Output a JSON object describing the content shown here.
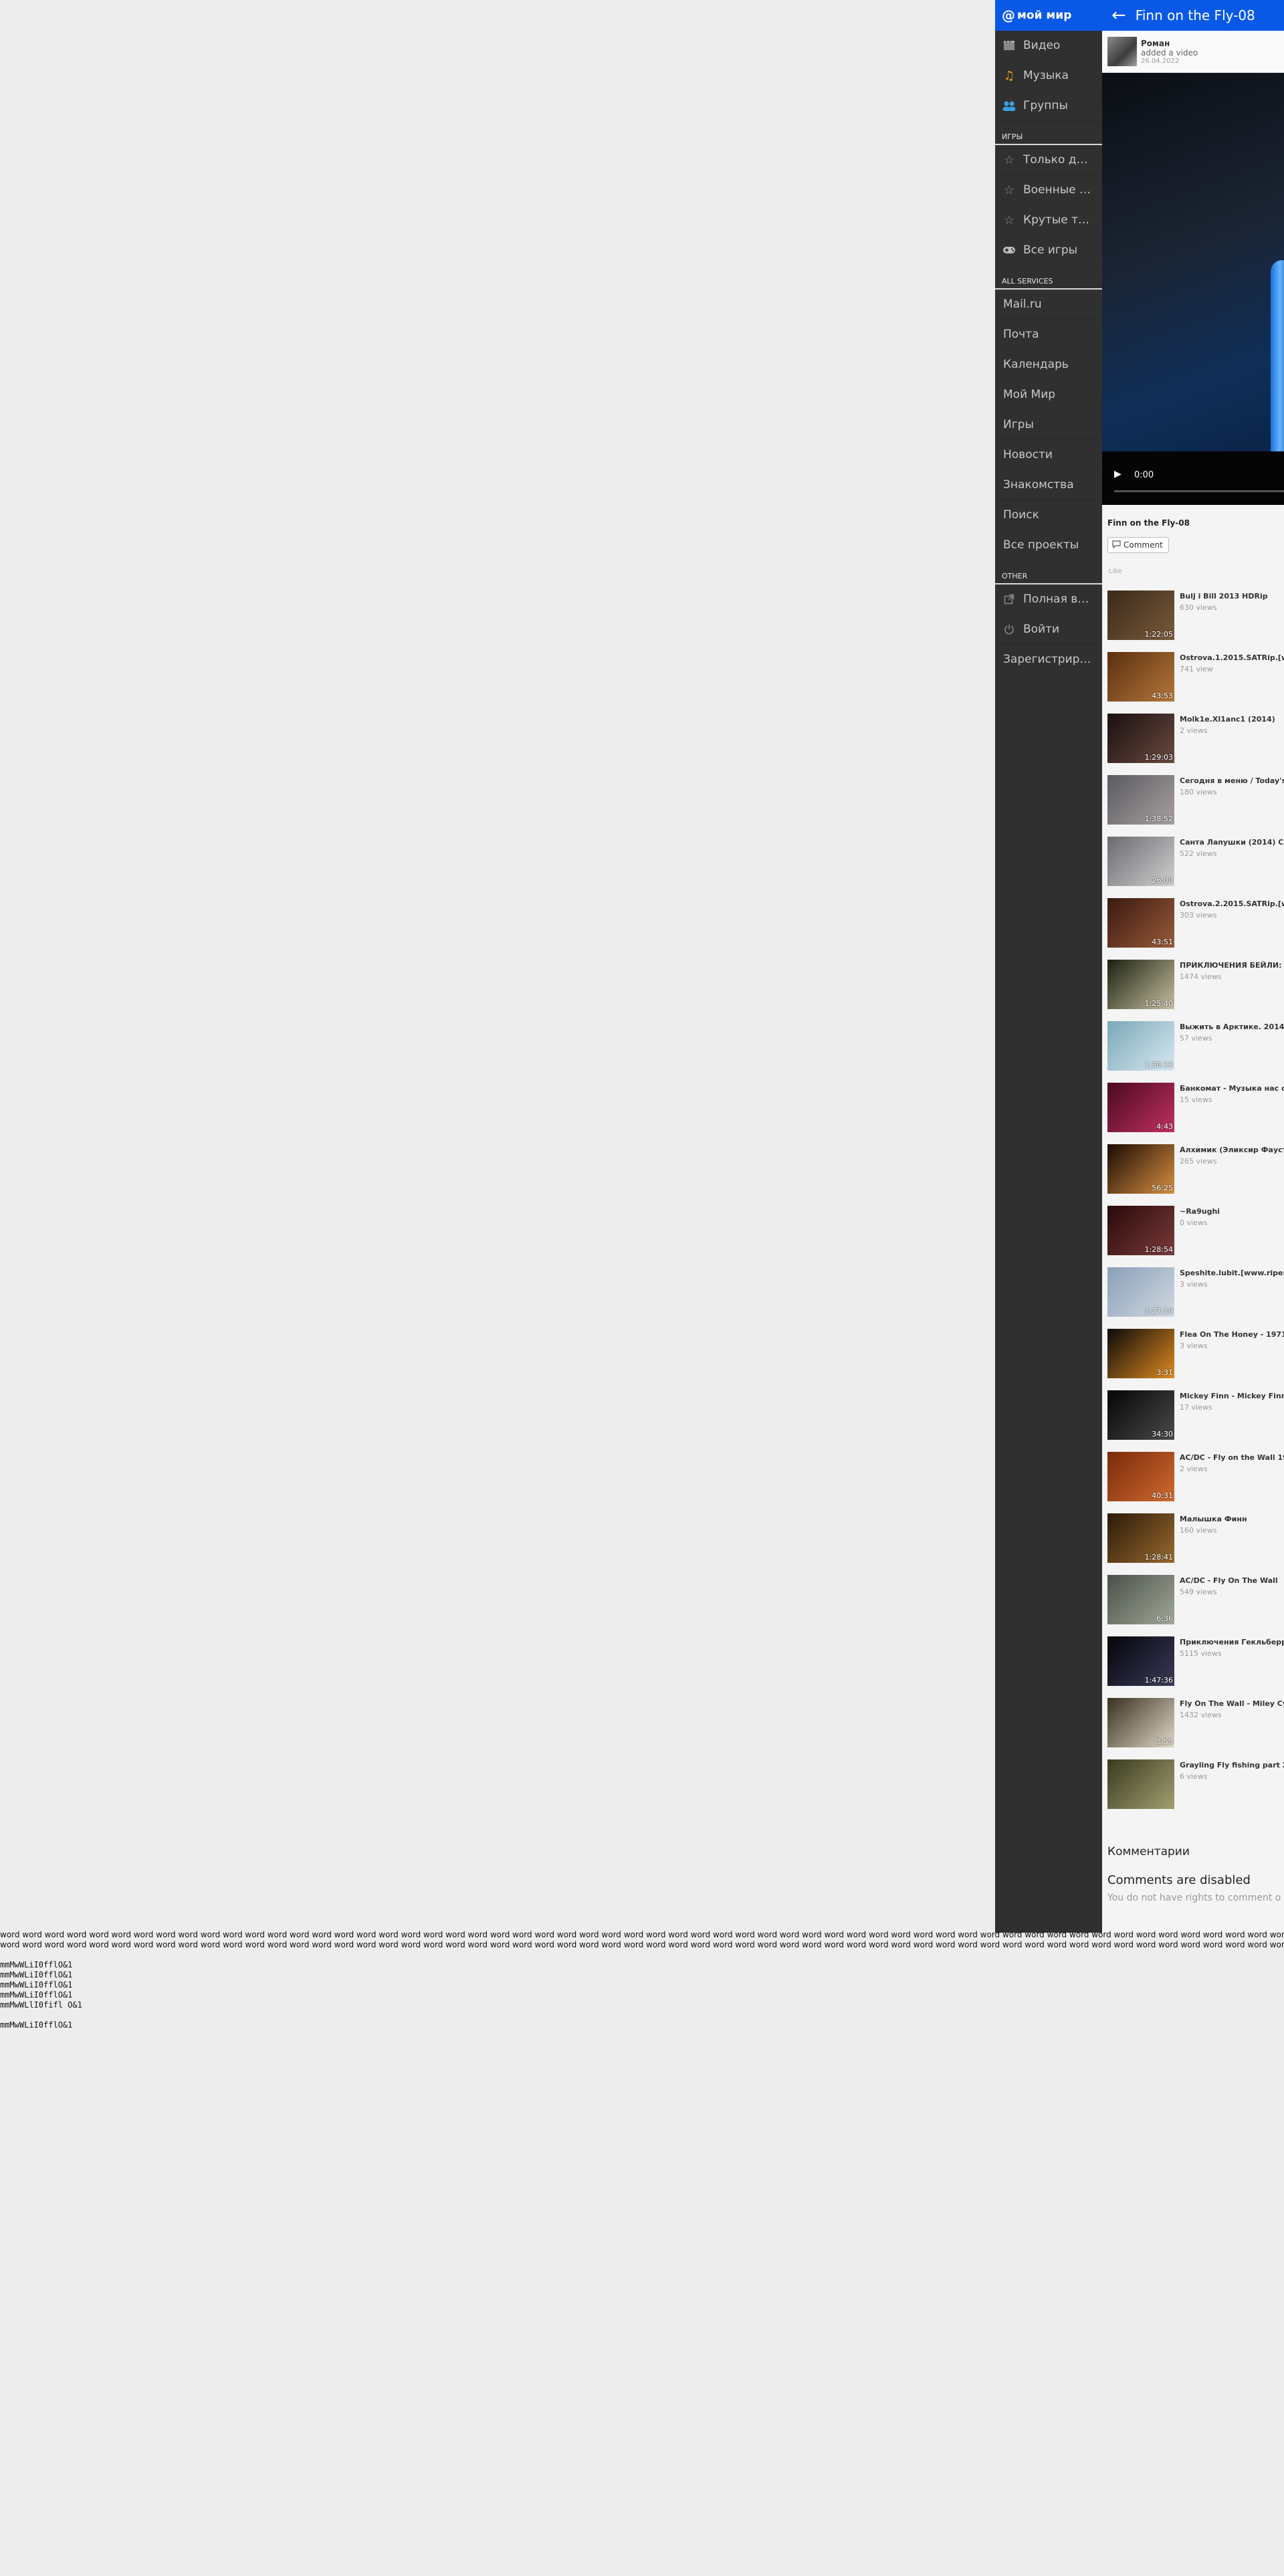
{
  "menu": {
    "brand": {
      "at": "@",
      "label": "мой мир"
    },
    "primary": [
      {
        "label": "Видео",
        "icon": "film-icon"
      },
      {
        "label": "Музыка",
        "icon": "music-note-icon"
      },
      {
        "label": "Группы",
        "icon": "people-icon"
      }
    ],
    "games_header": "ИГРЫ",
    "games": [
      {
        "label": "Только д…",
        "icon": "star-icon"
      },
      {
        "label": "Военные …",
        "icon": "star-icon"
      },
      {
        "label": "Крутые т…",
        "icon": "star-icon"
      },
      {
        "label": "Все игры",
        "icon": "gamepad-icon"
      }
    ],
    "services_header": "ALL SERVICES",
    "services": [
      "Mail.ru",
      "Почта",
      "Календарь",
      "Мой Мир",
      "Игры",
      "Новости",
      "Знакомства",
      "Поиск",
      "Все проекты"
    ],
    "other_header": "OTHER",
    "other": [
      {
        "label": "Полная в…",
        "icon": "external-link-icon"
      },
      {
        "label": "Войти",
        "icon": "power-icon"
      },
      {
        "label": "Зарегистрир…",
        "icon": ""
      }
    ]
  },
  "header": {
    "title": "Finn on the Fly-08"
  },
  "post": {
    "author": "Роман",
    "action": "added a video",
    "date": "26.04.2022"
  },
  "player": {
    "time": "0:00"
  },
  "video": {
    "title": "Finn on the Fly-08",
    "comment_label": "Comment",
    "likes": "Like"
  },
  "related": [
    {
      "title": "Bulj i Bill 2013 HDRip",
      "views": "630 views",
      "duration": "1:22:05",
      "color1": "#3a2a1a",
      "color2": "#7a5a3a"
    },
    {
      "title": "Ostrova.1.2015.SATRip.[ww",
      "views": "741 view",
      "duration": "43:53",
      "color1": "#5a3010",
      "color2": "#b5763a"
    },
    {
      "title": "Molk1e.Xl1anc1 (2014)",
      "views": "2 views",
      "duration": "1:29:03",
      "color1": "#1a1010",
      "color2": "#6a4a40"
    },
    {
      "title": "Сегодня в меню / Today's",
      "views": "180 views",
      "duration": "1:38:52",
      "color1": "#5a5a60",
      "color2": "#a8a0a0"
    },
    {
      "title": "Санта Лапушки (2014) СЦ",
      "views": "522 views",
      "duration": "26:00",
      "color1": "#6a6a70",
      "color2": "#d0d0d0"
    },
    {
      "title": "Ostrova.2.2015.SATRip.[ww",
      "views": "303 views",
      "duration": "43:51",
      "color1": "#3a1a10",
      "color2": "#9a5a3a"
    },
    {
      "title": "ПРИКЛЮЧЕНИЯ БЕЙЛИ: г",
      "views": "1474 views",
      "duration": "1:25:40",
      "color1": "#1a2010",
      "color2": "#c8c0a0"
    },
    {
      "title": "Выжить в Арктике. 2014.",
      "views": "57 views",
      "duration": "1:30:33",
      "color1": "#7aa8b8",
      "color2": "#d8e8f0"
    },
    {
      "title": "Банкомат - Музыка нас с",
      "views": "15 views",
      "duration": "4:43",
      "color1": "#4a0a20",
      "color2": "#c03060"
    },
    {
      "title": "Алхимик (Эликсир Фауст",
      "views": "265 views",
      "duration": "56:25",
      "color1": "#1a0a04",
      "color2": "#d89040"
    },
    {
      "title": "~Ra9ughi",
      "views": "0 views",
      "duration": "1:28:54",
      "color1": "#2a0a0a",
      "color2": "#7a3a3a"
    },
    {
      "title": "Speshite.lubit.[www.riper.",
      "views": "3 views",
      "duration": "1:27:19",
      "color1": "#8aa0b8",
      "color2": "#d0d8e0"
    },
    {
      "title": "Flea On The Honey - 1971 E",
      "views": "3 views",
      "duration": "3:31",
      "color1": "#0a0a0a",
      "color2": "#e08a20"
    },
    {
      "title": "Mickey Finn - Mickey Finn(",
      "views": "17 views",
      "duration": "34:30",
      "color1": "#050505",
      "color2": "#4a4a4a"
    },
    {
      "title": "AC/DC - Fly on the Wall 19",
      "views": "2 views",
      "duration": "40:31",
      "color1": "#7a2a0a",
      "color2": "#d06a30"
    },
    {
      "title": "Малышка Финн",
      "views": "160 views",
      "duration": "1:28:41",
      "color1": "#2a1a08",
      "color2": "#9a6a30"
    },
    {
      "title": "AC/DC - Fly On The Wall",
      "views": "549 views",
      "duration": "6:36",
      "color1": "#4a5048",
      "color2": "#a0a898"
    },
    {
      "title": "Приключения Гекльберр",
      "views": "5115 views",
      "duration": "1:47:36",
      "color1": "#05050a",
      "color2": "#3a3a5a"
    },
    {
      "title": "Fly On The Wall - Miley Cyr",
      "views": "1432 views",
      "duration": "3:53",
      "color1": "#3a3020",
      "color2": "#e0d8c8"
    },
    {
      "title": "Grayling Fly fishing part 2.",
      "views": "6 views",
      "duration": "",
      "color1": "#3a3a20",
      "color2": "#a0a070"
    }
  ],
  "comments": {
    "header": "Комментарии",
    "disabled": "Comments are disabled",
    "note": "You do not have rights to comment o"
  },
  "stray": {
    "word_line": "word word word word word word word word word word word word word word word word word word word word word word word word word word word word word word word word word word word word word word word word word word word word word word word word word word word word word word word word word word word word word word word word word word word word word word word word word word word word word word word word word word word word word word word word word word word word word word word word word word word word word word word word word word word word word word word word word word word word word word word word word word",
    "mono_lines": [
      "mmMwWLiI0fflO&1",
      "mmMwWLiI0fflO&1",
      "mmMwWLiI0fflO&1",
      "mmMwWLiI0fflO&1",
      "mmMwWLlI0fifl O&1",
      "",
      "mmMwWLiI0fflO&1"
    ]
  }
}
